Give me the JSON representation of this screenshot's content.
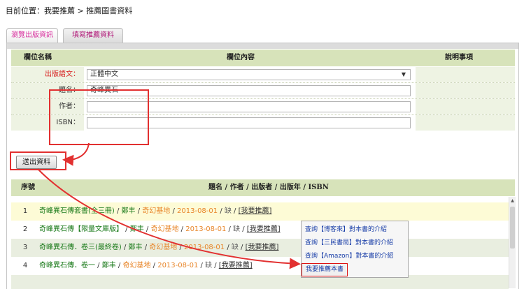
{
  "breadcrumb": "目前位置：我要推薦 > 推薦圖書資料",
  "tabs": [
    "瀏覽出版資訊",
    "填寫推薦資料"
  ],
  "form": {
    "headers": [
      "欄位名稱",
      "欄位內容",
      "說明事項"
    ],
    "language_label": "出版語文：",
    "language_value": "正體中文",
    "title_label": "題名：",
    "title_value": "奇峰異石",
    "author_label": "作者：",
    "author_value": "",
    "isbn_label": "ISBN：",
    "isbn_value": ""
  },
  "submit_button": "送出資料",
  "results": {
    "headers": [
      "序號",
      "題名 / 作者 / 出版者 / 出版年 / ISBN"
    ],
    "rows": [
      {
        "no": "1",
        "title": "奇峰異石傳套書(全三冊)",
        "author": "鄭丰",
        "publisher": "奇幻基地",
        "year": "2013-08-01",
        "isbn": "缺",
        "action": "[我要推薦]"
      },
      {
        "no": "2",
        "title": "奇峰異石傳【限量文庫版】",
        "author": "鄭丰",
        "publisher": "奇幻基地",
        "year": "2013-08-01",
        "isbn": "缺",
        "action": "[我要推薦]"
      },
      {
        "no": "3",
        "title": "奇峰異石傳．卷三(最終卷)",
        "author": "鄭丰",
        "publisher": "奇幻基地",
        "year": "2013-08-01",
        "isbn": "缺",
        "action": "[我要推薦]"
      },
      {
        "no": "4",
        "title": "奇峰異石傳．卷一",
        "author": "鄭丰",
        "publisher": "奇幻基地",
        "year": "2013-08-01",
        "isbn": "缺",
        "action": "[我要推薦]"
      }
    ]
  },
  "context_menu": [
    "查詢【博客來】對本書的介紹",
    "查詢【三民書局】對本書的介紹",
    "查詢【Amazon】對本書的介紹",
    "我要推薦本書"
  ]
}
